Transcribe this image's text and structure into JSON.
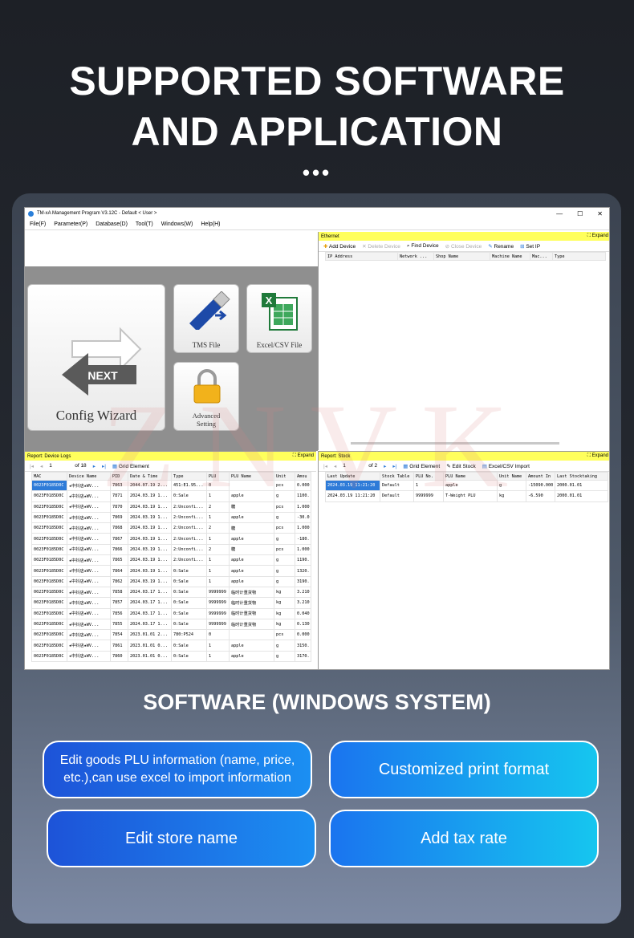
{
  "headline": {
    "line1": "SUPPORTED SOFTWARE",
    "line2": "AND APPLICATION",
    "dots": "•••"
  },
  "window": {
    "title": "TM-xA Management Program V3.12C - Default < User >",
    "controls": [
      "—",
      "☐",
      "✕"
    ],
    "menu": [
      "File(F)",
      "Parameter(P)",
      "Database(D)",
      "Tool(T)",
      "Windows(W)",
      "Help(H)"
    ],
    "tiles": {
      "config": "Config Wizard",
      "next": "NEXT",
      "tms": "TMS File",
      "excel": "Excel/CSV File",
      "adv1": "Advanced",
      "adv2": "Setting"
    },
    "ethernet": {
      "title": "Ethernet",
      "expand": "Expand",
      "toolbar": [
        "Add Device",
        "Delete Device",
        "Find Device",
        "Close Device",
        "Rename",
        "Set IP"
      ],
      "columns": [
        "IP Address",
        "Network ...",
        "Shop Name",
        "Machine Name",
        "Mac...",
        "Type"
      ]
    },
    "device_logs": {
      "title": "Report: Device Logs",
      "expand": "Expand",
      "page": "1",
      "of": "of 18",
      "grid": "Grid Element",
      "columns": [
        "MAC",
        "Device Name",
        "PID",
        "Date & Time",
        "Type",
        "PLU",
        "PLU Name",
        "Unit",
        "Amou"
      ],
      "rows": [
        [
          "0023F0185D0C",
          "★中抖店★WV...",
          "7863",
          "2044.07.19 2...",
          "451:E1.95...",
          "0",
          "",
          "pcs",
          "0.000"
        ],
        [
          "0023F0185D0C",
          "★中抖店★WV...",
          "7871",
          "2024.03.19 1...",
          "0:Sale",
          "1",
          "apple",
          "g",
          "1100."
        ],
        [
          "0023F0185D0C",
          "★中抖店★WV...",
          "7870",
          "2024.03.19 1...",
          "2:Unconfi...",
          "2",
          "糖",
          "pcs",
          "1.000"
        ],
        [
          "0023F0185D0C",
          "★中抖店★WV...",
          "7869",
          "2024.03.19 1...",
          "2:Unconfi...",
          "1",
          "apple",
          "g",
          "-30.0"
        ],
        [
          "0023F0185D0C",
          "★中抖店★WV...",
          "7868",
          "2024.03.19 1...",
          "2:Unconfi...",
          "2",
          "糖",
          "pcs",
          "1.000"
        ],
        [
          "0023F0185D0C",
          "★中抖店★WV...",
          "7867",
          "2024.03.19 1...",
          "2:Unconfi...",
          "1",
          "apple",
          "g",
          "-180."
        ],
        [
          "0023F0185D0C",
          "★中抖店★WV...",
          "7866",
          "2024.03.19 1...",
          "2:Unconfi...",
          "2",
          "糖",
          "pcs",
          "1.000"
        ],
        [
          "0023F0185D0C",
          "★中抖店★WV...",
          "7865",
          "2024.03.19 1...",
          "2:Unconfi...",
          "1",
          "apple",
          "g",
          "1190."
        ],
        [
          "0023F0185D0C",
          "★中抖店★WV...",
          "7864",
          "2024.03.19 1...",
          "0:Sale",
          "1",
          "apple",
          "g",
          "1320."
        ],
        [
          "0023F0185D0C",
          "★中抖店★WV...",
          "7862",
          "2024.03.19 1...",
          "0:Sale",
          "1",
          "apple",
          "g",
          "3190."
        ],
        [
          "0023F0185D0C",
          "★中抖店★WV...",
          "7858",
          "2024.03.17 1...",
          "0:Sale",
          "9999999",
          "临时计重货物",
          "kg",
          "3.210"
        ],
        [
          "0023F0185D0C",
          "★中抖店★WV...",
          "7857",
          "2024.03.17 1...",
          "0:Sale",
          "9999999",
          "临时计重货物",
          "kg",
          "3.210"
        ],
        [
          "0023F0185D0C",
          "★中抖店★WV...",
          "7856",
          "2024.03.17 1...",
          "0:Sale",
          "9999999",
          "临时计重货物",
          "kg",
          "0.040"
        ],
        [
          "0023F0185D0C",
          "★中抖店★WV...",
          "7855",
          "2024.03.17 1...",
          "0:Sale",
          "9999999",
          "临时计重货物",
          "kg",
          "0.130"
        ],
        [
          "0023F0185D0C",
          "★中抖店★WV...",
          "7854",
          "2023.01.01 2...",
          "780:P524",
          "0",
          "",
          "pcs",
          "0.000"
        ],
        [
          "0023F0185D0C",
          "★中抖店★WV...",
          "7861",
          "2023.01.01 0...",
          "0:Sale",
          "1",
          "apple",
          "g",
          "3150."
        ],
        [
          "0023F0185D0C",
          "★中抖店★WV...",
          "7860",
          "2023.01.01 0...",
          "0:Sale",
          "1",
          "apple",
          "g",
          "3170."
        ]
      ]
    },
    "stock": {
      "title": "Report: Stock",
      "expand": "Expand",
      "page": "1",
      "of": "of 2",
      "grid": "Grid Element",
      "edit": "Edit Stock",
      "import": "Excel/CSV Import",
      "columns": [
        "Last Update",
        "Stock Table",
        "PLU No.",
        "PLU Name",
        "Unit Name",
        "Amount In",
        "Last Stocktaking"
      ],
      "rows": [
        [
          "2024.03.19 11:21:20",
          "Default",
          "1",
          "apple",
          "g",
          "-15090.000",
          "2000.01.01"
        ],
        [
          "2024.03.19 11:21:20",
          "Default",
          "9999999",
          "T-Weight PLU",
          "kg",
          "-6.590",
          "2000.01.01"
        ]
      ]
    }
  },
  "watermark": "ZNVK",
  "subheading": "SOFTWARE (WINDOWS SYSTEM)",
  "features": [
    "Edit goods PLU information (name, price, etc.),can use excel to import information",
    "Customized print format",
    "Edit store name",
    "Add tax rate"
  ]
}
